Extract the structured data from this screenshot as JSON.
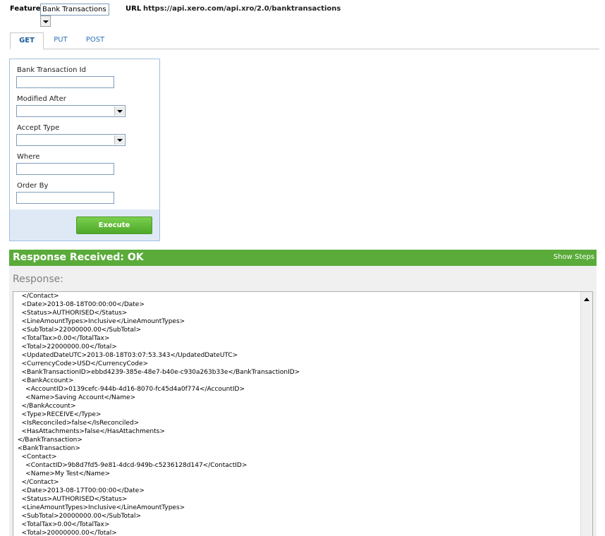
{
  "header": {
    "feature_label": "Feature",
    "feature_value": "Bank Transactions",
    "url_label": "URL",
    "url_value": "https://api.xero.com/api.xro/2.0/banktransactions"
  },
  "tabs": [
    {
      "label": "GET",
      "active": true
    },
    {
      "label": "PUT",
      "active": false
    },
    {
      "label": "POST",
      "active": false
    }
  ],
  "form": {
    "bank_transaction_id_label": "Bank Transaction Id",
    "modified_after_label": "Modified After",
    "accept_type_label": "Accept Type",
    "where_label": "Where",
    "order_by_label": "Order By",
    "execute_label": "Execute"
  },
  "response": {
    "status_title": "Response Received: OK",
    "show_steps": "Show Steps",
    "response_label": "Response:",
    "lines": [
      "    </Contact>",
      "    <Date>2013-08-18T00:00:00</Date>",
      "    <Status>AUTHORISED</Status>",
      "    <LineAmountTypes>Inclusive</LineAmountTypes>",
      "    <SubTotal>22000000.00</SubTotal>",
      "    <TotalTax>0.00</TotalTax>",
      "    <Total>22000000.00</Total>",
      "    <UpdatedDateUTC>2013-08-18T03:07:53.343</UpdatedDateUTC>",
      "    <CurrencyCode>USD</CurrencyCode>",
      "    <BankTransactionID>ebbd4239-385e-48e7-b40e-c930a263b33e</BankTransactionID>",
      "    <BankAccount>",
      "      <AccountID>0139cefc-944b-4d16-8070-fc45d4a0f774</AccountID>",
      "      <Name>Saving Account</Name>",
      "    </BankAccount>",
      "    <Type>RECEIVE</Type>",
      "    <IsReconciled>false</IsReconciled>",
      "    <HasAttachments>false</HasAttachments>",
      "  </BankTransaction>",
      "  <BankTransaction>",
      "    <Contact>",
      "      <ContactID>9b8d7fd5-9e81-4dcd-949b-c5236128d147</ContactID>",
      "      <Name>My Test</Name>",
      "    </Contact>",
      "    <Date>2013-08-17T00:00:00</Date>",
      "    <Status>AUTHORISED</Status>",
      "    <LineAmountTypes>Inclusive</LineAmountTypes>",
      "    <SubTotal>20000000.00</SubTotal>",
      "    <TotalTax>0.00</TotalTax>",
      "    <Total>20000000.00</Total>"
    ]
  },
  "colors": {
    "accent_green": "#5aab3a",
    "tab_blue": "#2a6fb8",
    "panel_border": "#9fbfe0"
  }
}
